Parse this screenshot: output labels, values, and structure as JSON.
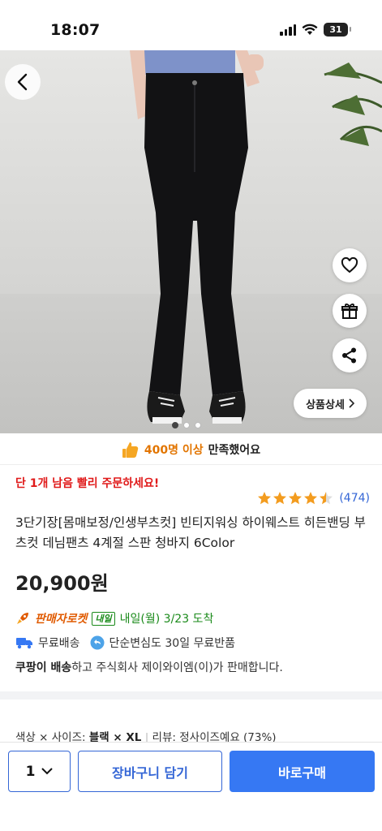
{
  "status_bar": {
    "time": "18:07",
    "battery": "31"
  },
  "hero": {
    "detail_button": "상품상세"
  },
  "satisfaction": {
    "count": "400명 이상",
    "text": "만족했어요"
  },
  "product": {
    "urgent": "단 1개 남음 빨리 주문하세요!",
    "rating_stars": 4.5,
    "review_count": "(474)",
    "title": "3단기장[몸매보정/인생부츠컷] 빈티지워싱 하이웨스트 히든밴딩 부츠컷 데님팬츠 4계절 스판 청바지 6Color",
    "price": "20,900원"
  },
  "delivery": {
    "rocket_label": "판매자로켓",
    "badge": "내일",
    "date": "내일(월) 3/23 도착",
    "free_shipping": "무료배송",
    "free_return": "단순변심도 30일 무료반품",
    "seller_strong": "쿠팡이 배송",
    "seller_rest": "하고 주식회사 제이와이엠(이)가 판매합니다."
  },
  "option_summary": {
    "prefix": "색상 × 사이즈:",
    "value": "블랙 × XL",
    "review": "리뷰: 정사이즈예요 (73%)"
  },
  "bottom_bar": {
    "quantity": "1",
    "cart_label": "장바구니 담기",
    "buy_label": "바로구매"
  },
  "colors": {
    "accent": "#3678f3",
    "price_red": "#e01a1a",
    "star": "#f39c1f",
    "rocket": "#e05a00"
  }
}
